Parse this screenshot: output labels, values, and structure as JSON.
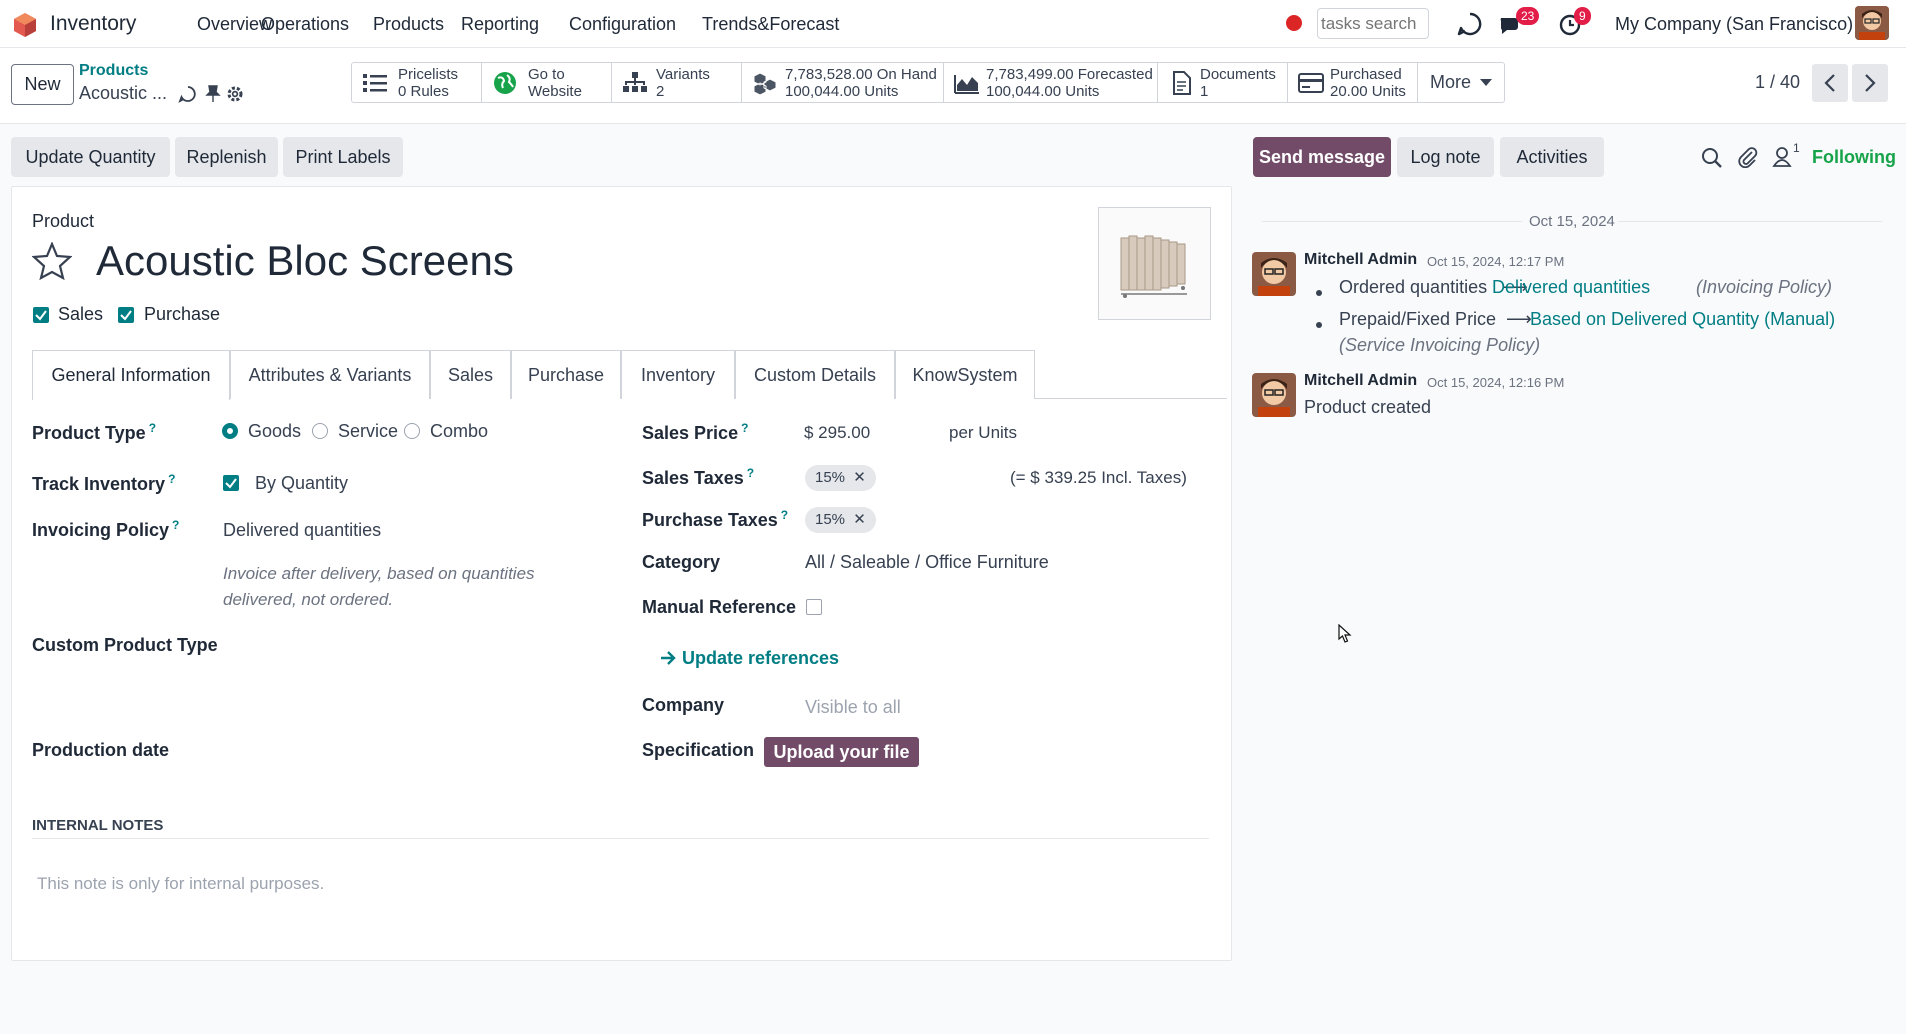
{
  "navbar": {
    "app_title": "Inventory",
    "menu": [
      "Overview",
      "Operations",
      "Products",
      "Reporting",
      "Configuration",
      "Trends&Forecast"
    ],
    "search_placeholder": "tasks search",
    "messages_count": "23",
    "activities_count": "9",
    "company": "My Company (San Francisco)"
  },
  "control_panel": {
    "new_label": "New",
    "breadcrumb_parent": "Products",
    "breadcrumb_current": "Acoustic ...",
    "smart_buttons": [
      {
        "line1": "Pricelists",
        "line2": "0 Rules",
        "icon": "list-icon"
      },
      {
        "line1": "Go to",
        "line2": "Website",
        "icon": "globe-icon"
      },
      {
        "line1": "Variants",
        "line2": "2",
        "icon": "sitemap-icon"
      },
      {
        "line1": "7,783,528.00 On Hand",
        "line2": "100,044.00 Units",
        "icon": "cubes-icon"
      },
      {
        "line1": "7,783,499.00 Forecasted",
        "line2": "100,044.00 Units",
        "icon": "area-chart-icon"
      },
      {
        "line1": "Documents",
        "line2": "1",
        "icon": "document-icon"
      },
      {
        "line1": "Purchased",
        "line2": "20.00 Units",
        "icon": "credit-card-icon"
      }
    ],
    "more_label": "More",
    "pager": "1 / 40"
  },
  "actions": {
    "update_quantity": "Update Quantity",
    "replenish": "Replenish",
    "print_labels": "Print Labels"
  },
  "product": {
    "section_label": "Product",
    "name": "Acoustic Bloc Screens",
    "sales_label": "Sales",
    "purchase_label": "Purchase"
  },
  "tabs": [
    "General Information",
    "Attributes & Variants",
    "Sales",
    "Purchase",
    "Inventory",
    "Custom Details",
    "KnowSystem"
  ],
  "general": {
    "product_type_label": "Product Type",
    "product_type_options": [
      "Goods",
      "Service",
      "Combo"
    ],
    "product_type_selected": "Goods",
    "track_inventory_label": "Track Inventory",
    "track_inventory_value": "By Quantity",
    "invoicing_policy_label": "Invoicing Policy",
    "invoicing_policy_value": "Delivered quantities",
    "invoicing_help_1": "Invoice after delivery, based on quantities",
    "invoicing_help_2": "delivered, not ordered.",
    "custom_product_type_label": "Custom Product Type",
    "production_date_label": "Production date",
    "sales_price_label": "Sales Price",
    "sales_price_value": "$ 295.00",
    "sales_price_unit": "per Units",
    "sales_taxes_label": "Sales Taxes",
    "sales_tax_tag": "15%",
    "incl_taxes": "(= $ 339.25 Incl. Taxes)",
    "purchase_taxes_label": "Purchase Taxes",
    "purchase_tax_tag": "15%",
    "category_label": "Category",
    "category_value": "All / Saleable / Office Furniture",
    "manual_reference_label": "Manual Reference",
    "update_references": "Update references",
    "company_label": "Company",
    "company_placeholder": "Visible to all",
    "specification_label": "Specification",
    "upload_label": "Upload your file",
    "internal_notes_label": "INTERNAL NOTES",
    "internal_notes_placeholder": "This note is only for internal purposes."
  },
  "chatter": {
    "send_message": "Send message",
    "log_note": "Log note",
    "activities": "Activities",
    "followers_count": "1",
    "following": "Following",
    "date_separator": "Oct 15, 2024",
    "messages": [
      {
        "author": "Mitchell Admin",
        "date": "Oct 15, 2024, 12:17 PM",
        "changes": [
          {
            "old": "Ordered quantities",
            "new": "Delivered quantities",
            "field": "(Invoicing Policy)"
          },
          {
            "old": "Prepaid/Fixed Price",
            "new": "Based on Delivered Quantity (Manual)",
            "field": "(Service Invoicing Policy)"
          }
        ]
      },
      {
        "author": "Mitchell Admin",
        "date": "Oct 15, 2024, 12:16 PM",
        "body": "Product created"
      }
    ]
  },
  "colors": {
    "primary": "#714b67",
    "accent": "#017e84",
    "badge": "#e11d48",
    "record": "#dc2626"
  }
}
